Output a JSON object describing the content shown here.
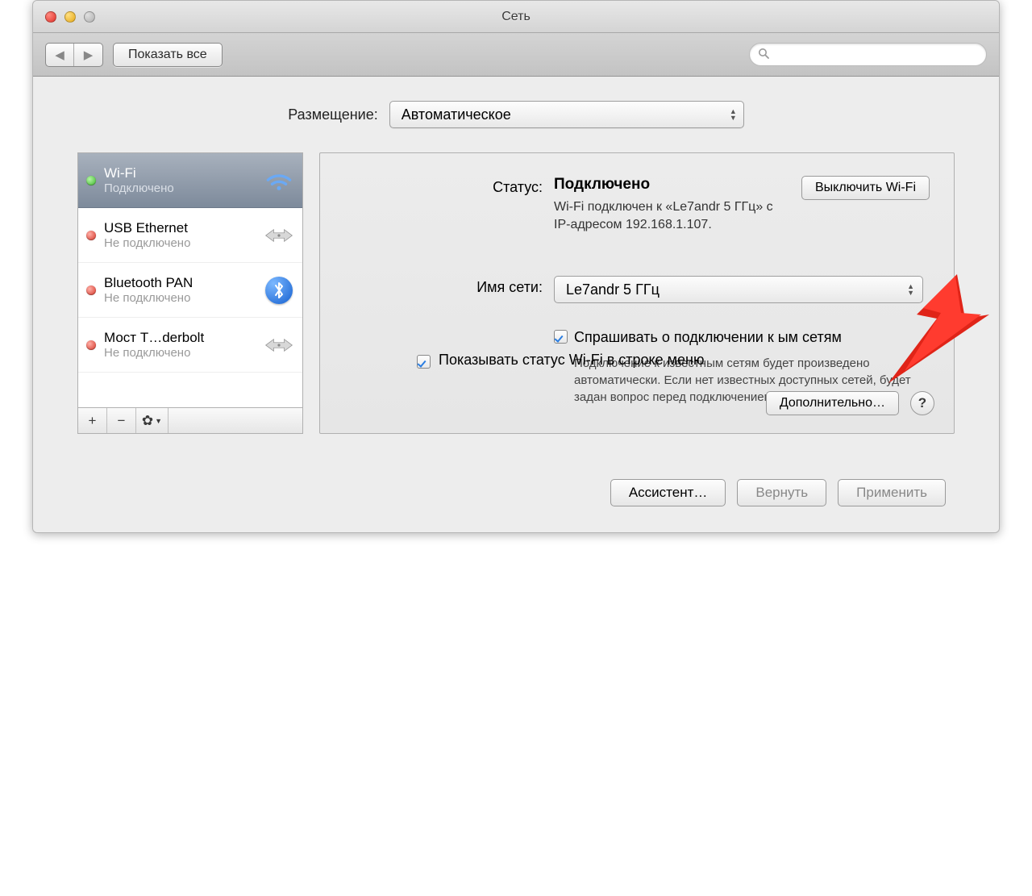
{
  "window": {
    "title": "Сеть"
  },
  "toolbar": {
    "show_all": "Показать все",
    "search_placeholder": ""
  },
  "location": {
    "label": "Размещение:",
    "value": "Автоматическое"
  },
  "sidebar": {
    "services": [
      {
        "name": "Wi-Fi",
        "status": "Подключено",
        "dot": "green",
        "icon": "wifi",
        "selected": true
      },
      {
        "name": "USB Ethernet",
        "status": "Не подключено",
        "dot": "red",
        "icon": "ethernet",
        "selected": false
      },
      {
        "name": "Bluetooth PAN",
        "status": "Не подключено",
        "dot": "red",
        "icon": "bluetooth",
        "selected": false
      },
      {
        "name": "Мост T…derbolt",
        "status": "Не подключено",
        "dot": "red",
        "icon": "ethernet",
        "selected": false
      }
    ]
  },
  "detail": {
    "status_label": "Статус:",
    "status_value": "Подключено",
    "toggle_button": "Выключить Wi-Fi",
    "conn_info": "Wi-Fi подключен к «Le7andr 5 ГГц» с IP-адресом 192.168.1.107.",
    "network_label": "Имя сети:",
    "network_value": "Le7andr 5 ГГц",
    "ask_checkbox": "Спрашивать о подключении к        ым сетям",
    "ask_help": "Подключение к известным сетям будет произведено автоматически. Если нет известных доступных сетей, будет задан вопрос перед подключением к новой сети.",
    "show_status": "Показывать статус Wi-Fi в строке меню",
    "advanced": "Дополнительно…"
  },
  "footer": {
    "assistant": "Ассистент…",
    "revert": "Вернуть",
    "apply": "Применить"
  }
}
